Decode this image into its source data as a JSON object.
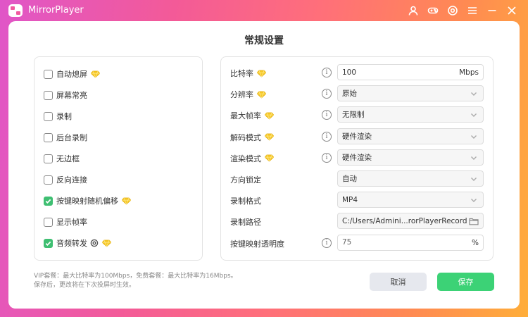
{
  "app": {
    "title": "MirrorPlayer"
  },
  "page": {
    "title": "常规设置"
  },
  "left_options": [
    {
      "label": "自动熄屏",
      "checked": false,
      "vip": true,
      "gear": false
    },
    {
      "label": "屏幕常亮",
      "checked": false,
      "vip": false,
      "gear": false
    },
    {
      "label": "录制",
      "checked": false,
      "vip": false,
      "gear": false
    },
    {
      "label": "后台录制",
      "checked": false,
      "vip": false,
      "gear": false
    },
    {
      "label": "无边框",
      "checked": false,
      "vip": false,
      "gear": false
    },
    {
      "label": "反向连接",
      "checked": false,
      "vip": false,
      "gear": false
    },
    {
      "label": "按键映射随机偏移",
      "checked": true,
      "vip": true,
      "gear": false
    },
    {
      "label": "显示帧率",
      "checked": false,
      "vip": false,
      "gear": false
    },
    {
      "label": "音频转发",
      "checked": true,
      "vip": true,
      "gear": true
    }
  ],
  "settings": [
    {
      "label": "比特率",
      "vip": true,
      "info": true,
      "type": "input",
      "value": "100",
      "suffix": "Mbps"
    },
    {
      "label": "分辨率",
      "vip": true,
      "info": true,
      "type": "select",
      "value": "原始"
    },
    {
      "label": "最大帧率",
      "vip": true,
      "info": true,
      "type": "select",
      "value": "无限制"
    },
    {
      "label": "解码模式",
      "vip": true,
      "info": true,
      "type": "select",
      "value": "硬件渲染"
    },
    {
      "label": "渲染模式",
      "vip": true,
      "info": true,
      "type": "select",
      "value": "硬件渲染"
    },
    {
      "label": "方向锁定",
      "vip": false,
      "info": false,
      "type": "select",
      "value": "自动"
    },
    {
      "label": "录制格式",
      "vip": false,
      "info": false,
      "type": "select",
      "value": "MP4"
    },
    {
      "label": "录制路径",
      "vip": false,
      "info": false,
      "type": "path",
      "value": "C:/Users/Admini...rorPlayerRecord"
    },
    {
      "label": "按键映射透明度",
      "vip": false,
      "info": true,
      "type": "input",
      "value": "75",
      "suffix": "%"
    }
  ],
  "footer": {
    "note_line1": "VIP套餐：最大比特率为100Mbps，免费套餐：最大比特率为16Mbps。",
    "note_line2": "保存后，更改将在下次投屏时生效。",
    "cancel_label": "取消",
    "save_label": "保存"
  },
  "colors": {
    "accent_green": "#3cd276",
    "vip_gold": "#f5c518"
  }
}
